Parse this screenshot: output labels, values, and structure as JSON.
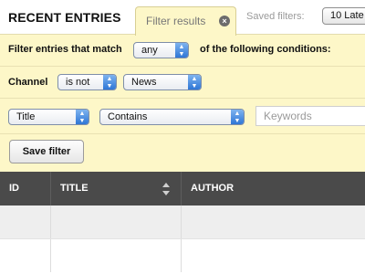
{
  "header": {
    "title": "RECENT ENTRIES",
    "tab_label": "Filter results",
    "saved_filters_label": "Saved filters:",
    "saved_filters_value": "10 Late"
  },
  "filter": {
    "intro_label": "Filter entries that match",
    "match_value": "any",
    "conditions_label": "of the following conditions:",
    "channel_label": "Channel",
    "channel_operator": "is not",
    "channel_value": "News",
    "field_value": "Title",
    "condition_value": "Contains",
    "keywords_placeholder": "Keywords",
    "save_label": "Save filter"
  },
  "table": {
    "columns": [
      "ID",
      "TITLE",
      "AUTHOR"
    ],
    "rows": [
      [
        "",
        "",
        ""
      ],
      [
        "",
        "",
        ""
      ]
    ]
  },
  "icons": {
    "tab_close": "close-icon",
    "select_arrow": "updown-arrows-icon",
    "sort": "sort-icon"
  },
  "colors": {
    "panel": "#fdf7c8",
    "header_bg": "#4a4a4a",
    "select_arrow": "#2f76d6",
    "row_alt": "#eeeeee"
  }
}
